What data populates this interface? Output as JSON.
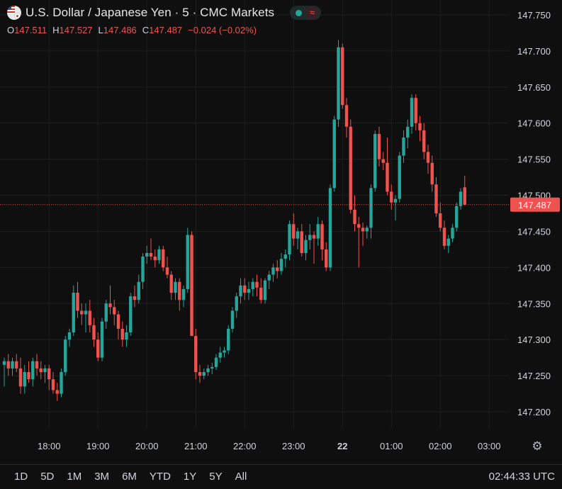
{
  "header": {
    "title": "U.S. Dollar / Japanese Yen · 5 · CMC Markets",
    "flag_icon": "usd-jpy-flag-icon",
    "status_dot_icon": "market-open-dot-icon",
    "status_wave_icon": "approx-icon",
    "wave_glyph": "≈"
  },
  "ohlc": {
    "o_label": "O",
    "o_value": "147.511",
    "h_label": "H",
    "h_value": "147.527",
    "l_label": "L",
    "l_value": "147.486",
    "c_label": "C",
    "c_value": "147.487",
    "change": "−0.024 (−0.02%)"
  },
  "time_ranges": [
    "1D",
    "5D",
    "1M",
    "3M",
    "6M",
    "YTD",
    "1Y",
    "5Y",
    "All"
  ],
  "clock": "02:44:33 UTC",
  "settings_icon": "settings-gear-icon",
  "colors": {
    "up": "#26a69a",
    "down": "#ef5350",
    "background": "#0f0f0f",
    "grid": "#1e1e1e",
    "text": "#d1d4dc"
  },
  "chart_data": {
    "type": "candlestick",
    "symbol": "USDJPY",
    "interval": "5",
    "source": "CMC Markets",
    "y_ticks": [
      "147.750",
      "147.700",
      "147.650",
      "147.600",
      "147.550",
      "147.500",
      "147.450",
      "147.400",
      "147.350",
      "147.300",
      "147.250",
      "147.200"
    ],
    "x_ticks": [
      {
        "label": "18:00",
        "bar": 11,
        "bold": false
      },
      {
        "label": "19:00",
        "bar": 23,
        "bold": false
      },
      {
        "label": "20:00",
        "bar": 35,
        "bold": false
      },
      {
        "label": "21:00",
        "bar": 47,
        "bold": false
      },
      {
        "label": "22:00",
        "bar": 59,
        "bold": false
      },
      {
        "label": "23:00",
        "bar": 71,
        "bold": false
      },
      {
        "label": "22",
        "bar": 83,
        "bold": true
      },
      {
        "label": "01:00",
        "bar": 95,
        "bold": false
      },
      {
        "label": "02:00",
        "bar": 107,
        "bold": false
      },
      {
        "label": "03:00",
        "bar": 119,
        "bold": false
      }
    ],
    "y_range": [
      147.165,
      147.765
    ],
    "grid": true,
    "last_price": "147.487",
    "candles": [
      [
        147.265,
        147.275,
        147.235,
        147.27
      ],
      [
        147.27,
        147.28,
        147.25,
        147.26
      ],
      [
        147.26,
        147.275,
        147.25,
        147.27
      ],
      [
        147.27,
        147.28,
        147.255,
        147.26
      ],
      [
        147.26,
        147.275,
        147.225,
        147.235
      ],
      [
        147.235,
        147.265,
        147.225,
        147.255
      ],
      [
        147.255,
        147.27,
        147.24,
        147.245
      ],
      [
        147.245,
        147.275,
        147.235,
        147.27
      ],
      [
        147.27,
        147.28,
        147.25,
        147.26
      ],
      [
        147.26,
        147.27,
        147.245,
        147.255
      ],
      [
        147.255,
        147.265,
        147.24,
        147.26
      ],
      [
        147.26,
        147.265,
        147.23,
        147.245
      ],
      [
        147.245,
        147.255,
        147.225,
        147.23
      ],
      [
        147.23,
        147.24,
        147.215,
        147.225
      ],
      [
        147.225,
        147.26,
        147.22,
        147.255
      ],
      [
        147.255,
        147.305,
        147.25,
        147.3
      ],
      [
        147.3,
        147.315,
        147.29,
        147.31
      ],
      [
        147.31,
        147.375,
        147.305,
        147.365
      ],
      [
        147.365,
        147.38,
        147.33,
        147.34
      ],
      [
        147.34,
        147.35,
        147.32,
        147.335
      ],
      [
        147.335,
        147.35,
        147.31,
        147.34
      ],
      [
        147.34,
        147.355,
        147.31,
        147.32
      ],
      [
        147.32,
        147.33,
        147.29,
        147.3
      ],
      [
        147.3,
        147.31,
        147.27,
        147.275
      ],
      [
        147.275,
        147.33,
        147.27,
        147.325
      ],
      [
        147.325,
        147.355,
        147.315,
        147.35
      ],
      [
        147.35,
        147.375,
        147.335,
        147.345
      ],
      [
        147.345,
        147.355,
        147.32,
        147.335
      ],
      [
        147.335,
        147.34,
        147.3,
        147.315
      ],
      [
        147.315,
        147.325,
        147.29,
        147.3
      ],
      [
        147.3,
        147.32,
        147.29,
        147.31
      ],
      [
        147.31,
        147.365,
        147.305,
        147.36
      ],
      [
        147.36,
        147.375,
        147.345,
        147.355
      ],
      [
        147.355,
        147.39,
        147.35,
        147.38
      ],
      [
        147.38,
        147.42,
        147.37,
        147.415
      ],
      [
        147.415,
        147.43,
        147.405,
        147.42
      ],
      [
        147.42,
        147.44,
        147.41,
        147.415
      ],
      [
        147.415,
        147.425,
        147.4,
        147.41
      ],
      [
        147.41,
        147.43,
        147.405,
        147.425
      ],
      [
        147.425,
        147.43,
        147.395,
        147.4
      ],
      [
        147.4,
        147.415,
        147.385,
        147.39
      ],
      [
        147.39,
        147.395,
        147.355,
        147.365
      ],
      [
        147.365,
        147.385,
        147.355,
        147.38
      ],
      [
        147.38,
        147.385,
        147.34,
        147.355
      ],
      [
        147.355,
        147.375,
        147.345,
        147.37
      ],
      [
        147.37,
        147.455,
        147.365,
        147.445
      ],
      [
        147.445,
        147.45,
        147.32,
        147.305
      ],
      [
        147.305,
        147.315,
        147.245,
        147.255
      ],
      [
        147.255,
        147.265,
        147.24,
        147.25
      ],
      [
        147.25,
        147.26,
        147.245,
        147.255
      ],
      [
        147.255,
        147.265,
        147.25,
        147.26
      ],
      [
        147.26,
        147.268,
        147.252,
        147.262
      ],
      [
        147.262,
        147.28,
        147.258,
        147.275
      ],
      [
        147.275,
        147.29,
        147.268,
        147.282
      ],
      [
        147.282,
        147.29,
        147.275,
        147.285
      ],
      [
        147.285,
        147.32,
        147.28,
        147.315
      ],
      [
        147.315,
        147.345,
        147.31,
        147.34
      ],
      [
        147.34,
        147.365,
        147.33,
        147.36
      ],
      [
        147.36,
        147.385,
        147.35,
        147.375
      ],
      [
        147.375,
        147.385,
        147.355,
        147.365
      ],
      [
        147.365,
        147.38,
        147.355,
        147.37
      ],
      [
        147.37,
        147.385,
        147.36,
        147.38
      ],
      [
        147.38,
        147.39,
        147.36,
        147.372
      ],
      [
        147.372,
        147.385,
        147.35,
        147.355
      ],
      [
        147.355,
        147.385,
        147.35,
        147.382
      ],
      [
        147.382,
        147.395,
        147.37,
        147.39
      ],
      [
        147.39,
        147.405,
        147.38,
        147.4
      ],
      [
        147.4,
        147.41,
        147.385,
        147.395
      ],
      [
        147.395,
        147.42,
        147.39,
        147.412
      ],
      [
        147.412,
        147.425,
        147.4,
        147.418
      ],
      [
        147.418,
        147.465,
        147.41,
        147.46
      ],
      [
        147.46,
        147.475,
        147.43,
        147.44
      ],
      [
        147.44,
        147.455,
        147.425,
        147.45
      ],
      [
        147.45,
        147.46,
        147.415,
        147.42
      ],
      [
        147.42,
        147.445,
        147.41,
        147.438
      ],
      [
        147.438,
        147.46,
        147.425,
        147.445
      ],
      [
        147.445,
        147.45,
        147.405,
        147.44
      ],
      [
        147.44,
        147.47,
        147.43,
        147.46
      ],
      [
        147.46,
        147.465,
        147.41,
        147.425
      ],
      [
        147.425,
        147.435,
        147.395,
        147.4
      ],
      [
        147.4,
        147.515,
        147.395,
        147.51
      ],
      [
        147.51,
        147.61,
        147.505,
        147.605
      ],
      [
        147.605,
        147.715,
        147.595,
        147.705
      ],
      [
        147.705,
        147.71,
        147.62,
        147.625
      ],
      [
        147.625,
        147.635,
        147.58,
        147.595
      ],
      [
        147.595,
        147.605,
        147.475,
        147.48
      ],
      [
        147.48,
        147.5,
        147.45,
        147.46
      ],
      [
        147.46,
        147.47,
        147.4,
        147.455
      ],
      [
        147.455,
        147.462,
        147.43,
        147.45
      ],
      [
        147.45,
        147.458,
        147.44,
        147.455
      ],
      [
        147.455,
        147.515,
        147.44,
        147.51
      ],
      [
        147.51,
        147.59,
        147.505,
        147.585
      ],
      [
        147.585,
        147.595,
        147.54,
        147.55
      ],
      [
        147.55,
        147.56,
        147.535,
        147.545
      ],
      [
        147.545,
        147.58,
        147.5,
        147.505
      ],
      [
        147.505,
        147.515,
        147.48,
        147.49
      ],
      [
        147.49,
        147.5,
        147.465,
        147.495
      ],
      [
        147.495,
        147.56,
        147.49,
        147.555
      ],
      [
        147.555,
        147.59,
        147.545,
        147.58
      ],
      [
        147.58,
        147.605,
        147.565,
        147.595
      ],
      [
        147.595,
        147.64,
        147.585,
        147.635
      ],
      [
        147.635,
        147.64,
        147.59,
        147.6
      ],
      [
        147.6,
        147.61,
        147.575,
        147.59
      ],
      [
        147.59,
        147.6,
        147.55,
        147.56
      ],
      [
        147.56,
        147.57,
        147.53,
        147.545
      ],
      [
        147.545,
        147.555,
        147.505,
        147.515
      ],
      [
        147.515,
        147.525,
        147.47,
        147.475
      ],
      [
        147.475,
        147.49,
        147.45,
        147.455
      ],
      [
        147.455,
        147.465,
        147.425,
        147.43
      ],
      [
        147.43,
        147.445,
        147.42,
        147.44
      ],
      [
        147.44,
        147.46,
        147.435,
        147.455
      ],
      [
        147.455,
        147.49,
        147.45,
        147.485
      ],
      [
        147.485,
        147.51,
        147.48,
        147.505
      ],
      [
        147.511,
        147.527,
        147.486,
        147.487
      ]
    ]
  }
}
